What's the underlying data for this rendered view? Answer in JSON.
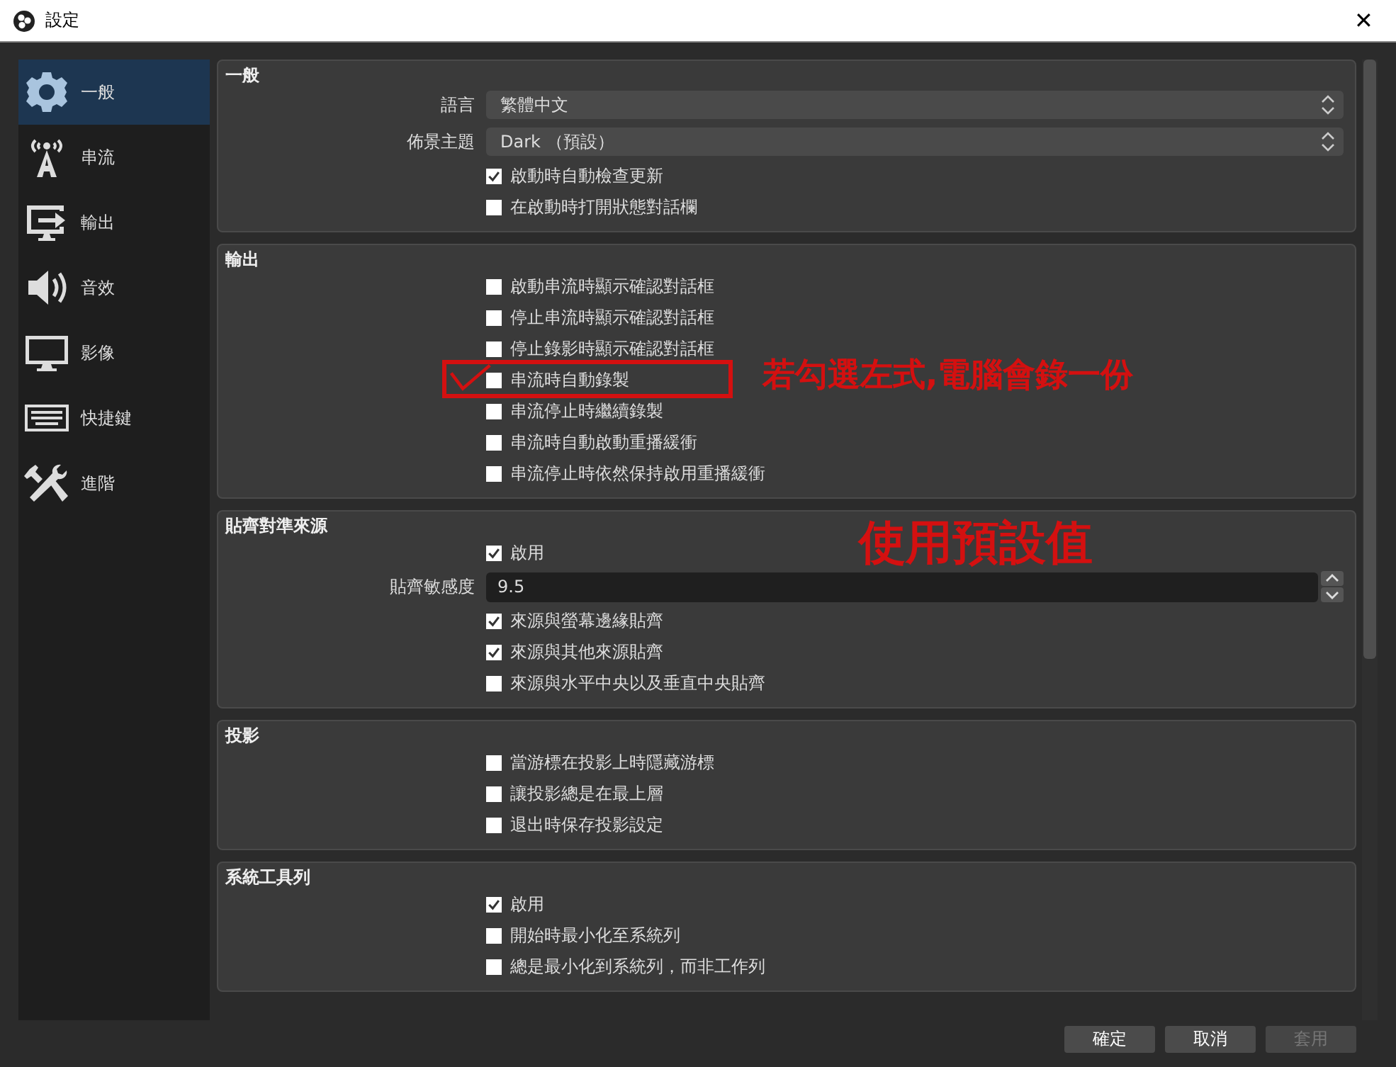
{
  "window": {
    "title": "設定",
    "close": "✕"
  },
  "sidebar": {
    "items": [
      {
        "label": "一般",
        "selected": true
      },
      {
        "label": "串流",
        "selected": false
      },
      {
        "label": "輸出",
        "selected": false
      },
      {
        "label": "音效",
        "selected": false
      },
      {
        "label": "影像",
        "selected": false
      },
      {
        "label": "快捷鍵",
        "selected": false
      },
      {
        "label": "進階",
        "selected": false
      }
    ]
  },
  "sections": [
    {
      "title": "一般",
      "rows": [
        {
          "kind": "combo",
          "label": "語言",
          "value": "繁體中文"
        },
        {
          "kind": "combo",
          "label": "佈景主題",
          "value": "Dark （預設）"
        },
        {
          "kind": "checkbox",
          "label": "啟動時自動檢查更新",
          "checked": true
        },
        {
          "kind": "checkbox",
          "label": "在啟動時打開狀態對話欄",
          "checked": false
        }
      ]
    },
    {
      "title": "輸出",
      "rows": [
        {
          "kind": "checkbox",
          "label": "啟動串流時顯示確認對話框",
          "checked": false
        },
        {
          "kind": "checkbox",
          "label": "停止串流時顯示確認對話框",
          "checked": false
        },
        {
          "kind": "checkbox",
          "label": "停止錄影時顯示確認對話框",
          "checked": false
        },
        {
          "kind": "checkbox",
          "label": "串流時自動錄製",
          "checked": false,
          "annotation": "若勾選左式,電腦會錄一份"
        },
        {
          "kind": "checkbox",
          "label": "串流停止時繼續錄製",
          "checked": false
        },
        {
          "kind": "checkbox",
          "label": "串流時自動啟動重播緩衝",
          "checked": false
        },
        {
          "kind": "checkbox",
          "label": "串流停止時依然保持啟用重播緩衝",
          "checked": false
        }
      ]
    },
    {
      "title": "貼齊對準來源",
      "annotation": "使用預設值",
      "rows": [
        {
          "kind": "checkbox",
          "label": "啟用",
          "checked": true
        },
        {
          "kind": "spin",
          "label": "貼齊敏感度",
          "value": "9.5"
        },
        {
          "kind": "checkbox",
          "label": "來源與螢幕邊緣貼齊",
          "checked": true
        },
        {
          "kind": "checkbox",
          "label": "來源與其他來源貼齊",
          "checked": true
        },
        {
          "kind": "checkbox",
          "label": "來源與水平中央以及垂直中央貼齊",
          "checked": false
        }
      ]
    },
    {
      "title": "投影",
      "rows": [
        {
          "kind": "checkbox",
          "label": "當游標在投影上時隱藏游標",
          "checked": false
        },
        {
          "kind": "checkbox",
          "label": "讓投影總是在最上層",
          "checked": false
        },
        {
          "kind": "checkbox",
          "label": "退出時保存投影設定",
          "checked": false
        }
      ]
    },
    {
      "title": "系統工具列",
      "rows": [
        {
          "kind": "checkbox",
          "label": "啟用",
          "checked": true
        },
        {
          "kind": "checkbox",
          "label": "開始時最小化至系統列",
          "checked": false
        },
        {
          "kind": "checkbox",
          "label": "總是最小化到系統列，而非工作列",
          "checked": false
        }
      ]
    }
  ],
  "buttons": [
    {
      "label": "確定",
      "disabled": false
    },
    {
      "label": "取消",
      "disabled": false
    },
    {
      "label": "套用",
      "disabled": true
    }
  ]
}
